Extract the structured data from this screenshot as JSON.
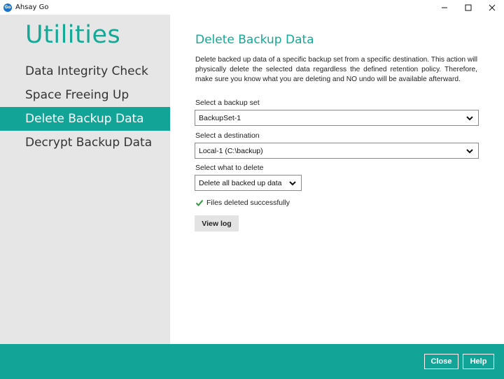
{
  "window": {
    "title": "Ahsay Go",
    "logo_text": "Go",
    "controls": [
      "minimize-icon",
      "maximize-icon",
      "close-icon"
    ]
  },
  "sidebar": {
    "title": "Utilities",
    "items": [
      {
        "label": "Data Integrity Check",
        "active": false
      },
      {
        "label": "Space Freeing Up",
        "active": false
      },
      {
        "label": "Delete Backup Data",
        "active": true
      },
      {
        "label": "Decrypt Backup Data",
        "active": false
      }
    ]
  },
  "main": {
    "title": "Delete Backup Data",
    "description": "Delete backed up data of a specific backup set from a specific destination. This action will physically delete the selected data regardless the defined retention policy. Therefore, make sure you know what you are deleting and NO undo will be available afterward.",
    "backup_set": {
      "label": "Select a backup set",
      "value": "BackupSet-1"
    },
    "destination": {
      "label": "Select a destination",
      "value": "Local-1 (C:\\backup)"
    },
    "what_to_delete": {
      "label": "Select what to delete",
      "value": "Delete all backed up data"
    },
    "status": {
      "text": "Files deleted successfully",
      "icon": "checkmark-icon",
      "color": "#2e9b3a"
    },
    "view_log_label": "View log"
  },
  "footer": {
    "close_label": "Close",
    "help_label": "Help"
  },
  "colors": {
    "accent": "#12a597",
    "sidebar_bg": "#e6e6e6"
  }
}
